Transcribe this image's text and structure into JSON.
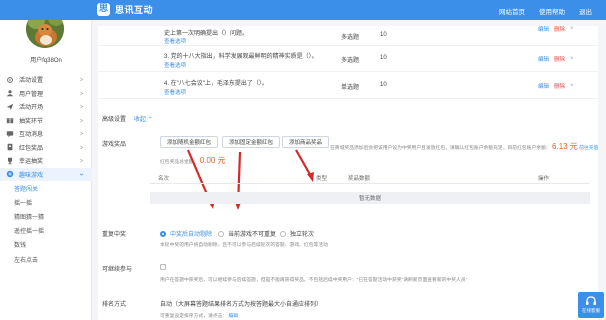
{
  "header": {
    "logo_mark": "思",
    "brand": "思讯互动",
    "links": [
      "网站首页",
      "使用帮助",
      "退出"
    ]
  },
  "user": {
    "name": "用户fq38On"
  },
  "sidebar": {
    "items": [
      {
        "label": "活动设置",
        "icon": "gear-icon"
      },
      {
        "label": "用户管理",
        "icon": "user-icon"
      },
      {
        "label": "活动开场",
        "icon": "send-icon"
      },
      {
        "label": "抽奖环节",
        "icon": "gift-icon"
      },
      {
        "label": "互动消息",
        "icon": "chat-icon"
      },
      {
        "label": "红包奖品",
        "icon": "redpack-icon"
      },
      {
        "label": "幸运抽奖",
        "icon": "trophy-icon"
      },
      {
        "label": "趣味游戏",
        "icon": "game-icon"
      }
    ],
    "sub_items": [
      "答题闯关",
      "摇一摇",
      "猜图猜一猜",
      "遥控摇一摇",
      "数钱",
      "左右点击"
    ]
  },
  "questions": [
    {
      "text": "史上第一次明确提出（）问题。",
      "link": "查看选项",
      "type": "多选题",
      "score": "10"
    },
    {
      "text": "3. 党的十八大指出，科学发展观最鲜明的精神实质是（）。",
      "link": "查看选项",
      "type": "多选题",
      "score": "10"
    },
    {
      "text": "4. 在\"八七会议\"上，毛泽东提出了（）。",
      "link": "查看选项",
      "type": "单选题",
      "score": "10"
    }
  ],
  "ops": {
    "edit": "编辑",
    "delete": "删除",
    "close": "×"
  },
  "advanced": {
    "label": "高级设置",
    "value": "收起",
    "arrow": "⌃"
  },
  "prize": {
    "label": "游戏奖品",
    "buttons": [
      "添加随机金额红包",
      "添加固定金额红包",
      "添加商品奖品"
    ],
    "note_prefix": "在商城奖品添加后会把该用户设为中奖用户且发放红包，请确认红包账户余额充足，目前红包账户余额：",
    "balance": "6.13 元",
    "recharge": "前往充值",
    "total_label": "红包奖品总金额：",
    "total": "0.00 元"
  },
  "prize_table": {
    "headers": [
      "名次",
      "类型",
      "奖品数额",
      "操作"
    ],
    "empty": "暂无数据"
  },
  "repeat": {
    "label": "重复中奖",
    "options": [
      "中奖后自动剔除",
      "当前游戏不可重复",
      "独立轮次"
    ],
    "note": "本轮中奖的用户将自动剔除，且不可以参与后续轮次的答题、游戏、红包等活动"
  },
  "participate": {
    "label": "可继续参与",
    "note": "用户在答题中获奖后，可以继续参与后续答题，但是不能再获得奖品。不包括后续中奖用户：\"已在答题活动中获奖\"请刷新页面查看新的中奖人员\""
  },
  "ranking": {
    "label": "排名方式",
    "value": "自动（大屏幕答题结果排名方式为按答题最大小自通应排列）",
    "note_prefix": "可重复设定排序方式，请点击：",
    "note_link": "编辑"
  },
  "float": {
    "label": "在线客服"
  }
}
